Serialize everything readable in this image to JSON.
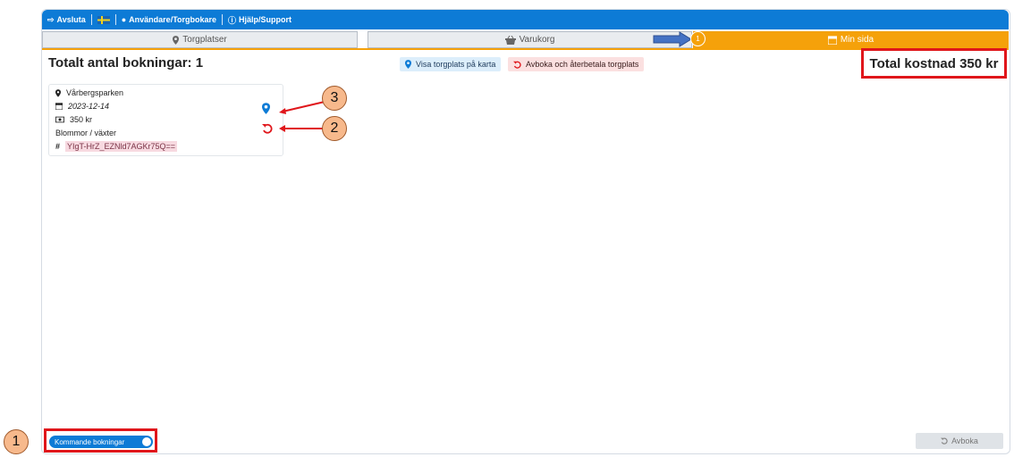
{
  "topbar": {
    "logout_label": "Avsluta",
    "user_label": "Användare/Torgbokare",
    "help_label": "Hjälp/Support"
  },
  "tabs": [
    {
      "label": "Torgplatser",
      "icon": "map-marker-icon"
    },
    {
      "label": "Varukorg",
      "icon": "basket-icon"
    },
    {
      "label": "Min sida",
      "icon": "calendar-icon"
    }
  ],
  "badge_count": "1",
  "header": {
    "title": "Totalt antal bokningar: 1",
    "map_button": "Visa torgplats på karta",
    "cancel_button": "Avboka och återbetala torgplats",
    "total_cost": "Total kostnad 350 kr"
  },
  "booking": {
    "place": "Vårbergsparken",
    "date": "2023-12-14",
    "price": "350 kr",
    "category": "Blommor / växter",
    "code": "YIgT-HrZ_EZNld7AGKr75Q=="
  },
  "annotations": {
    "one": "1",
    "two": "2",
    "three": "3"
  },
  "footer": {
    "toggle_label": "Kommande bokningar",
    "avboka_label": "Avboka"
  },
  "colors": {
    "primary": "#0d7bd6",
    "accent": "#f5a10a",
    "annotation_red": "#e0161b"
  }
}
